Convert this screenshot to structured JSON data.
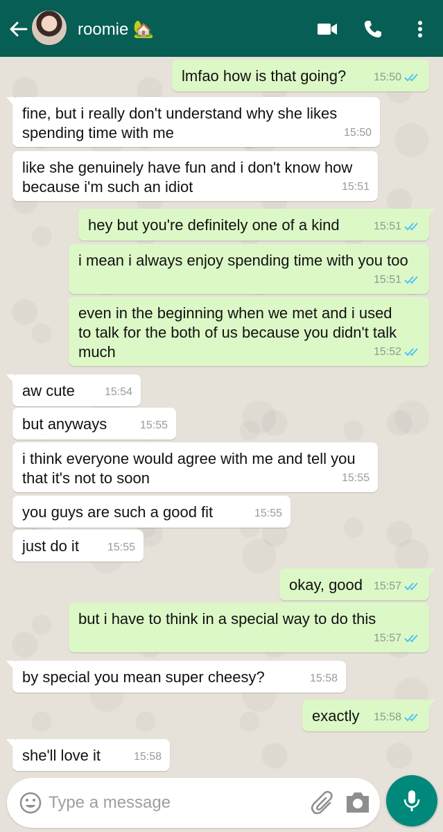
{
  "header": {
    "contact_name": "roomie 🏡",
    "icons": [
      "back-arrow-icon",
      "avatar",
      "video-call-icon",
      "phone-icon",
      "more-vertical-icon"
    ]
  },
  "messages": [
    {
      "dir": "out",
      "text": "lmfao how is that going?",
      "time": "15:50",
      "read": true
    },
    {
      "dir": "in",
      "text": "fine, but i really don't understand why she likes spending time with me",
      "time": "15:50"
    },
    {
      "dir": "in",
      "text": "like she genuinely have fun and i don't know how because i'm such an idiot",
      "time": "15:51"
    },
    {
      "dir": "out",
      "text": "hey but you're definitely one of a kind",
      "time": "15:51",
      "read": true
    },
    {
      "dir": "out",
      "text": "i mean i always enjoy spending time with you too",
      "time": "15:51",
      "read": true
    },
    {
      "dir": "out",
      "text": "even in the beginning when we met and i used to talk for the both of us because you didn't talk much",
      "time": "15:52",
      "read": true
    },
    {
      "dir": "in",
      "text": "aw cute",
      "time": "15:54"
    },
    {
      "dir": "in",
      "text": "but anyways",
      "time": "15:55"
    },
    {
      "dir": "in",
      "text": "i think everyone would agree with me and tell you that it's not to soon",
      "time": "15:55"
    },
    {
      "dir": "in",
      "text": "you guys are such a good fit",
      "time": "15:55"
    },
    {
      "dir": "in",
      "text": "just do it",
      "time": "15:55"
    },
    {
      "dir": "out",
      "text": "okay, good",
      "time": "15:57",
      "read": true
    },
    {
      "dir": "out",
      "text": "but i have to think in a special way to do this",
      "time": "15:57",
      "read": true
    },
    {
      "dir": "in",
      "text": "by special you mean super cheesy?",
      "time": "15:58"
    },
    {
      "dir": "out",
      "text": "exactly",
      "time": "15:58",
      "read": true
    },
    {
      "dir": "in",
      "text": "she'll love it",
      "time": "15:58"
    }
  ],
  "composer": {
    "placeholder": "Type a message",
    "icons": [
      "emoji-icon",
      "attach-icon",
      "camera-icon",
      "mic-icon"
    ]
  },
  "colors": {
    "header": "#075e54",
    "outgoing_bubble": "#dcf8c6",
    "incoming_bubble": "#ffffff",
    "read_ticks": "#4fc3f7",
    "mic_button": "#00897b"
  }
}
